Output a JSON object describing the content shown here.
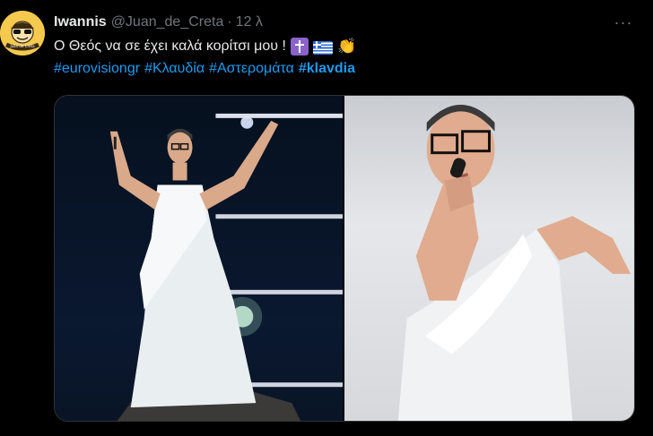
{
  "tweet": {
    "display_name": "Iwannis",
    "handle": "@Juan_de_Creta",
    "separator": "·",
    "time": "12 λ",
    "more_label": "···",
    "text": "Ο Θεός να σε έχει καλά κορίτσι μου !",
    "emojis": [
      "orthodox-cross-emoji",
      "greek-flag-emoji",
      "clapping-hands-emoji"
    ],
    "hashtags": [
      "#eurovisiongr",
      "#Κλαυδία",
      "#Αστερομάτα",
      "#klavdia"
    ],
    "avatar_text": "Juan de Creta",
    "link_color": "#1d9bf0",
    "muted_color": "#71767b"
  },
  "media": {
    "images": [
      "stage-performance-photo",
      "singing-closeup-photo"
    ]
  }
}
